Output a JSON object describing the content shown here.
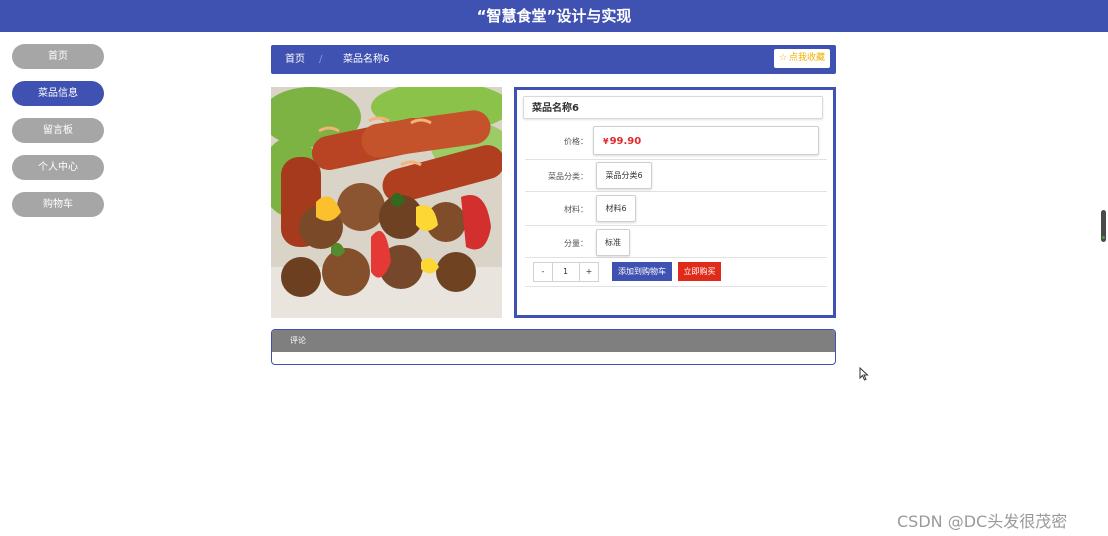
{
  "header": {
    "title": "“智慧食堂”设计与实现"
  },
  "sidebar": {
    "items": [
      {
        "label": "首页"
      },
      {
        "label": "菜品信息"
      },
      {
        "label": "留言板"
      },
      {
        "label": "个人中心"
      },
      {
        "label": "购物车"
      }
    ],
    "active_index": 1
  },
  "breadcrumb": {
    "home": "首页",
    "separator": "/",
    "current": "菜品名称6",
    "favorite_icon": "star-outline-icon",
    "favorite_label": "点我收藏"
  },
  "product": {
    "image_icon": "grilled-sausage-skewer-photo",
    "title": "菜品名称6",
    "price_label": "价格：",
    "currency": "¥",
    "price": "99.90",
    "category_label": "菜品分类：",
    "category_value": "菜品分类6",
    "material_label": "材料：",
    "material_value": "材料6",
    "portion_label": "分量：",
    "portion_value": "标准",
    "quantity": "1",
    "minus_label": "-",
    "plus_label": "+",
    "add_cart_label": "添加到购物车",
    "buy_now_label": "立即购买"
  },
  "comments": {
    "title": "评论"
  },
  "watermark": "CSDN @DC头发很茂密",
  "colors": {
    "primary": "#3f51b1",
    "sidebar_inactive": "#a6a6a6",
    "price": "#e02a2a",
    "buy": "#e02a1a",
    "favorite": "#f0b000"
  }
}
